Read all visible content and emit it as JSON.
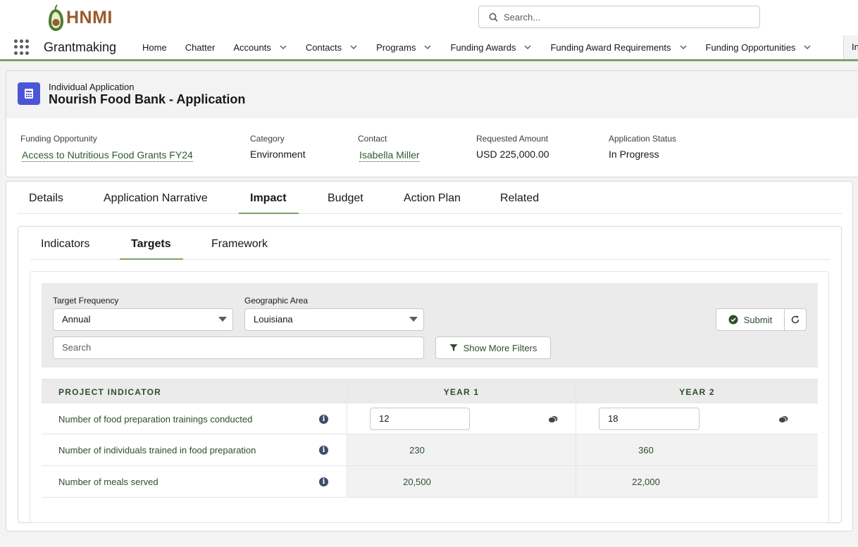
{
  "header": {
    "logo_text": "HNMI",
    "search_placeholder": "Search..."
  },
  "nav": {
    "app_name": "Grantmaking",
    "items": [
      {
        "label": "Home",
        "has_menu": false
      },
      {
        "label": "Chatter",
        "has_menu": false
      },
      {
        "label": "Accounts",
        "has_menu": true
      },
      {
        "label": "Contacts",
        "has_menu": true
      },
      {
        "label": "Programs",
        "has_menu": true
      },
      {
        "label": "Funding Awards",
        "has_menu": true
      },
      {
        "label": "Funding Award Requirements",
        "has_menu": true
      },
      {
        "label": "Funding Opportunities",
        "has_menu": true
      }
    ],
    "overflow_tab": "In"
  },
  "record": {
    "type": "Individual Application",
    "title": "Nourish Food Bank - Application",
    "fields": [
      {
        "label": "Funding Opportunity",
        "value": "Access to Nutritious Food Grants FY24",
        "is_link": true
      },
      {
        "label": "Category",
        "value": "Environment",
        "is_link": false
      },
      {
        "label": "Contact",
        "value": "Isabella Miller",
        "is_link": true
      },
      {
        "label": "Requested Amount",
        "value": "USD 225,000.00",
        "is_link": false
      },
      {
        "label": "Application Status",
        "value": "In Progress",
        "is_link": false
      }
    ]
  },
  "tabs": [
    "Details",
    "Application Narrative",
    "Impact",
    "Budget",
    "Action Plan",
    "Related"
  ],
  "active_tab": "Impact",
  "subtabs": [
    "Indicators",
    "Targets",
    "Framework"
  ],
  "active_subtab": "Targets",
  "filters": {
    "frequency_label": "Target Frequency",
    "frequency_value": "Annual",
    "area_label": "Geographic Area",
    "area_value": "Louisiana",
    "search_placeholder": "Search",
    "more_filters_label": "Show More Filters",
    "submit_label": "Submit"
  },
  "table": {
    "columns": [
      "PROJECT INDICATOR",
      "YEAR 1",
      "YEAR 2"
    ],
    "rows": [
      {
        "indicator": "Number of food preparation trainings conducted",
        "year1": "12",
        "year2": "18",
        "editable": true
      },
      {
        "indicator": "Number of individuals trained in food preparation",
        "year1": "230",
        "year2": "360",
        "editable": false
      },
      {
        "indicator": "Number of meals served",
        "year1": "20,500",
        "year2": "22,000",
        "editable": false
      }
    ]
  },
  "colors": {
    "accent_green": "#7aa36a",
    "text_green": "#2e4d2e",
    "record_icon": "#4a56d6",
    "logo_brown": "#9a5a2c"
  }
}
